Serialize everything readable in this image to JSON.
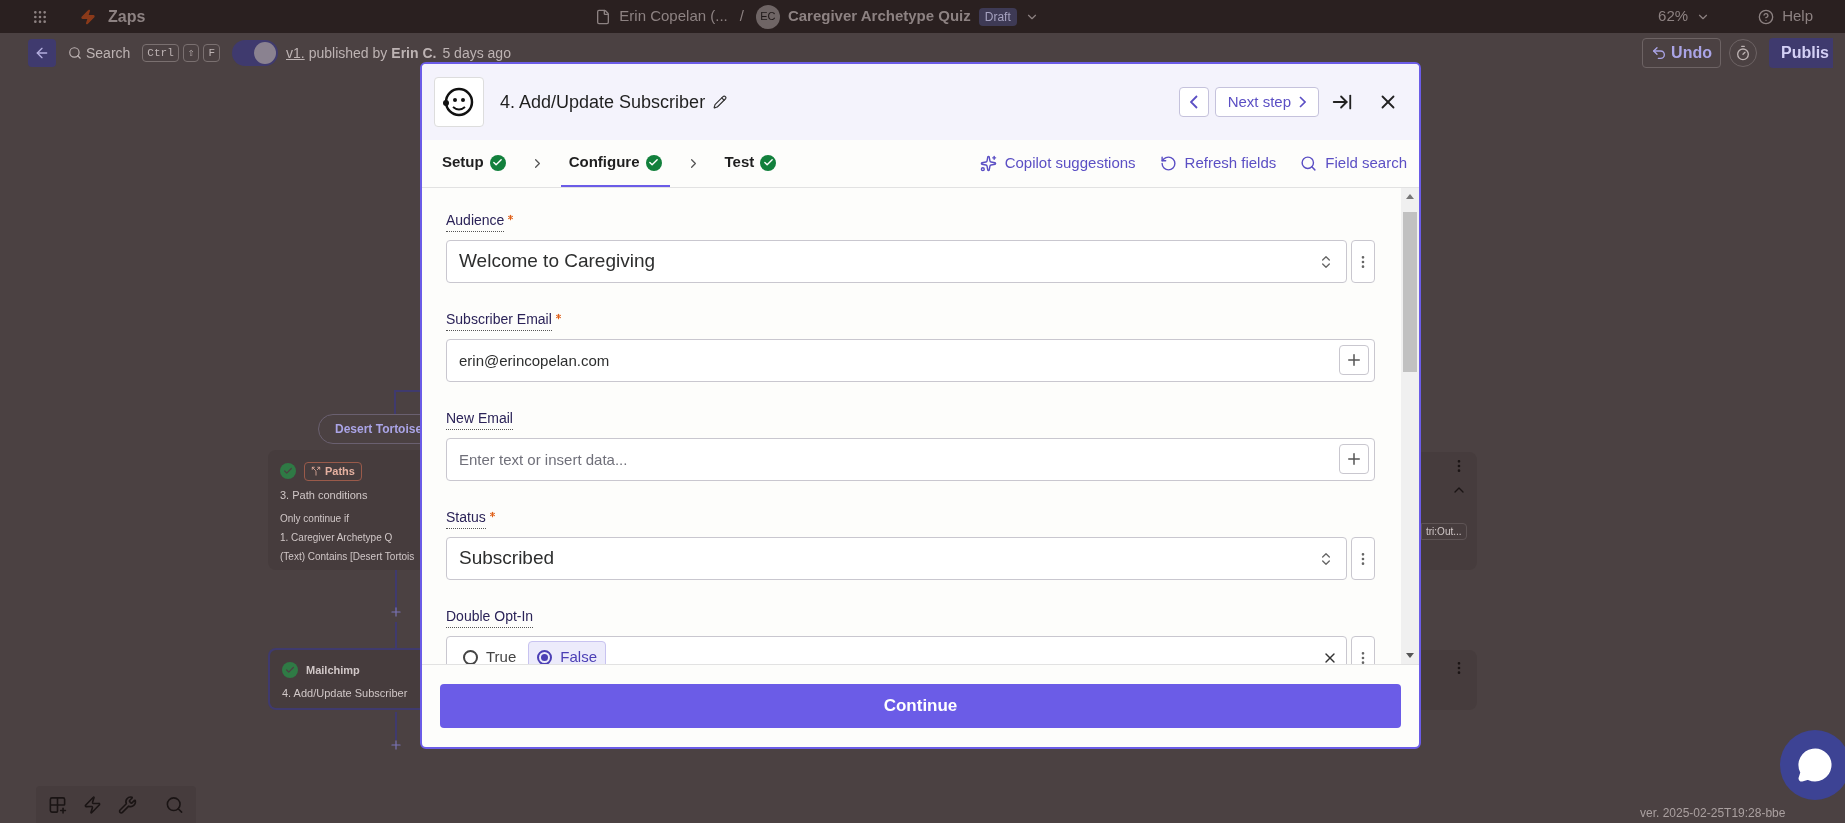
{
  "top_bar": {
    "app": "Zaps",
    "folder": "Erin Copelan (...",
    "separator": "/",
    "avatar": "EC",
    "zap_title": "Caregiver Archetype Quiz",
    "status_badge": "Draft",
    "zoom": "62%",
    "help": "Help"
  },
  "toolbar": {
    "search": "Search",
    "shortcut_keys": [
      "Ctrl",
      "⇧",
      "F"
    ],
    "toggle_on": true,
    "version": "v1.",
    "published_by": "published by",
    "author": "Erin C.",
    "time": "5 days ago",
    "undo": "Undo",
    "publish": "Publis"
  },
  "canvas": {
    "branch_label": "Desert Tortoise",
    "path_node": {
      "done": true,
      "app": "Paths",
      "title": "3. Path conditions",
      "rule_heading": "Only continue if",
      "rule_field": "1. Caregiver Archetype Q",
      "rule_text": "(Text) Contains [Desert Tortois"
    },
    "action_node": {
      "done": true,
      "selected": true,
      "app": "Mailchimp",
      "title": "4. Add/Update Subscriber"
    },
    "right_chip": "tri:Out...",
    "version": "ver. 2025-02-25T19:28-bbe"
  },
  "modal": {
    "title": "4. Add/Update Subscriber",
    "next": "Next step",
    "tabs": [
      {
        "label": "Setup",
        "done": true,
        "selected": false
      },
      {
        "label": "Configure",
        "done": true,
        "selected": true
      },
      {
        "label": "Test",
        "done": true,
        "selected": false
      }
    ],
    "links": [
      "Copilot suggestions",
      "Refresh fields",
      "Field search"
    ],
    "fields": [
      {
        "kind": "select",
        "label": "Audience",
        "required": true,
        "value": "Welcome to Caregiving"
      },
      {
        "kind": "input",
        "label": "Subscriber Email",
        "required": true,
        "value": "erin@erincopelan.com"
      },
      {
        "kind": "input",
        "label": "New Email",
        "required": false,
        "placeholder": "Enter text or insert data..."
      },
      {
        "kind": "select",
        "label": "Status",
        "required": true,
        "value": "Subscribed"
      },
      {
        "kind": "radio",
        "label": "Double Opt-In",
        "required": false,
        "options": [
          {
            "label": "True",
            "selected": false
          },
          {
            "label": "False",
            "selected": true
          }
        ]
      }
    ],
    "continue": "Continue"
  }
}
